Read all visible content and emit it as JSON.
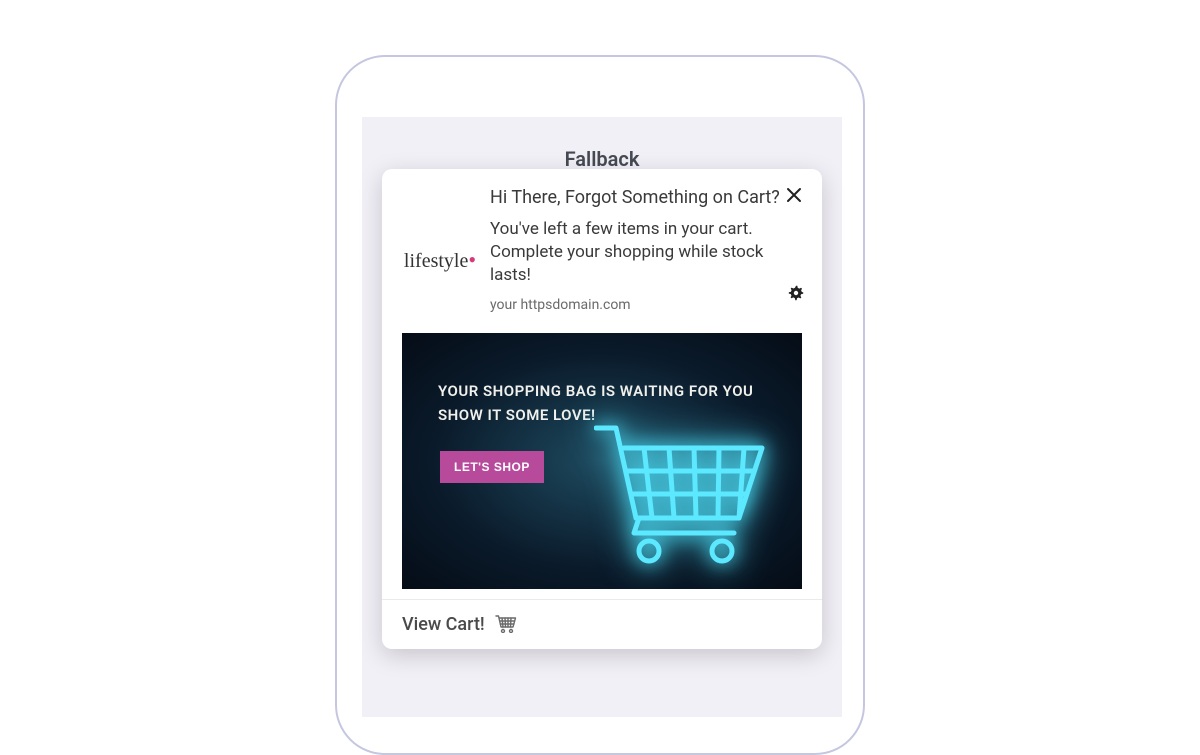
{
  "page": {
    "fallback_label": "Fallback"
  },
  "notification": {
    "logo_text": "lifestyle",
    "title": "Hi There, Forgot Something on Cart?",
    "body": "You've left a few items in your cart. Complete your shopping while stock lasts!",
    "domain": "your httpsdomain.com"
  },
  "hero": {
    "line1": "YOUR SHOPPING BAG IS WAITING FOR YOU",
    "line2": "SHOW IT SOME LOVE!",
    "button_label": "LET'S SHOP"
  },
  "action": {
    "label": "View Cart!"
  }
}
